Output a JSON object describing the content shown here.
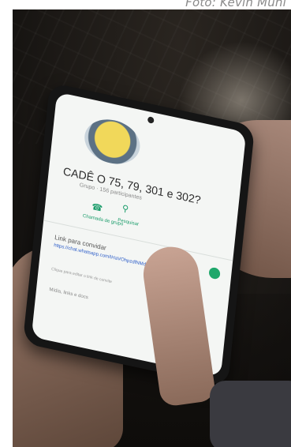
{
  "photo_credit": "Foto: Kevin Muni",
  "phone_screen": {
    "group_name": "CADÊ O 75, 79, 301 e 302?",
    "group_info": "Grupo · 156 participantes",
    "actions": [
      {
        "icon": "phone-icon",
        "label": "Chamada de grupo"
      },
      {
        "icon": "search-icon",
        "label": "Pesquisar"
      }
    ],
    "invite_link_label": "Link para convidar",
    "invite_link_url": "https://chat.whatsapp.com/IHaVOhpzdfNMdlpo8j2jhU",
    "invite_link_note": "Clique para editar o link de convite",
    "media_label": "Mídia, links e docs"
  },
  "colors": {
    "accent": "#1a9c6a",
    "link": "#2b5cc8"
  }
}
